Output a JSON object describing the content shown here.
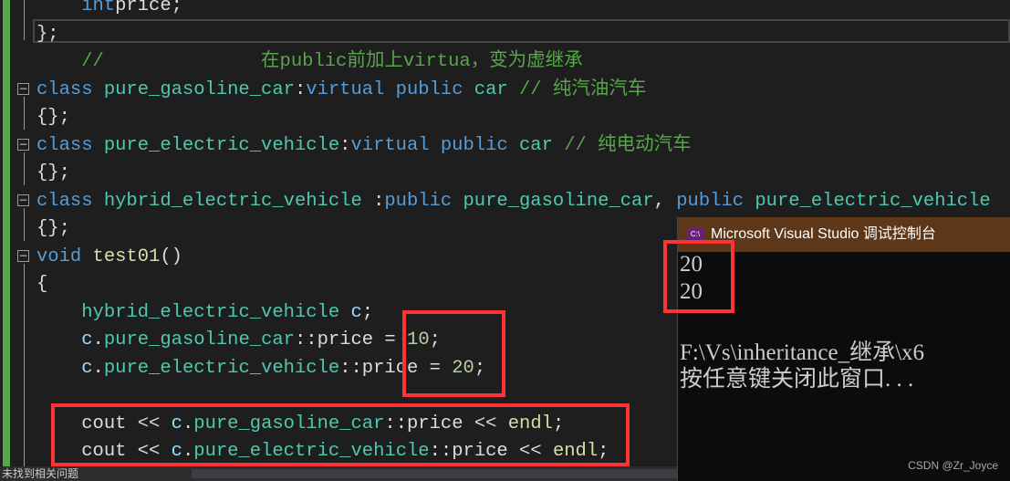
{
  "editor": {
    "lines": [
      {
        "indent": "    ",
        "parts": [
          [
            "kw",
            "int"
          ],
          [
            "",
            "price;"
          ]
        ]
      },
      {
        "indent": "",
        "parts": [
          [
            "",
            "};"
          ]
        ]
      },
      {
        "indent": "    ",
        "parts": [
          [
            "cm",
            "//              在public前加上virtua，变为虚继承"
          ]
        ]
      },
      {
        "indent": "",
        "parts": [
          [
            "kw",
            "class "
          ],
          [
            "ty",
            "pure_gasoline_car"
          ],
          [
            "",
            ":"
          ],
          [
            "kw",
            "virtual public "
          ],
          [
            "ty",
            "car"
          ],
          [
            "cm",
            " // 纯汽油汽车"
          ]
        ]
      },
      {
        "indent": "",
        "parts": [
          [
            "",
            "{};"
          ]
        ]
      },
      {
        "indent": "",
        "parts": [
          [
            "kw",
            "class "
          ],
          [
            "ty",
            "pure_electric_vehicle"
          ],
          [
            "",
            ":"
          ],
          [
            "kw",
            "virtual public "
          ],
          [
            "ty",
            "car"
          ],
          [
            "cm",
            " // 纯电动汽车"
          ]
        ]
      },
      {
        "indent": "",
        "parts": [
          [
            "",
            "{};"
          ]
        ]
      },
      {
        "indent": "",
        "parts": [
          [
            "kw",
            "class "
          ],
          [
            "ty",
            "hybrid_electric_vehicle"
          ],
          [
            "",
            " :"
          ],
          [
            "kw",
            "public "
          ],
          [
            "ty",
            "pure_gasoline_car"
          ],
          [
            "",
            ", "
          ],
          [
            "kw",
            "public "
          ],
          [
            "ty",
            "pure_electric_vehicle"
          ]
        ]
      },
      {
        "indent": "",
        "parts": [
          [
            "",
            "{};"
          ]
        ]
      },
      {
        "indent": "",
        "parts": [
          [
            "kw",
            "void "
          ],
          [
            "fn",
            "test01"
          ],
          [
            "",
            "()"
          ]
        ]
      },
      {
        "indent": "",
        "parts": [
          [
            "",
            "{"
          ]
        ]
      },
      {
        "indent": "    ",
        "parts": [
          [
            "ty",
            "hybrid_electric_vehicle "
          ],
          [
            "var",
            "c"
          ],
          [
            "",
            ";"
          ]
        ]
      },
      {
        "indent": "    ",
        "parts": [
          [
            "var",
            "c"
          ],
          [
            "",
            "."
          ],
          [
            "ty",
            "pure_gasoline_car"
          ],
          [
            "",
            "::price = "
          ],
          [
            "num",
            "10"
          ],
          [
            "",
            ";"
          ]
        ]
      },
      {
        "indent": "    ",
        "parts": [
          [
            "var",
            "c"
          ],
          [
            "",
            "."
          ],
          [
            "ty",
            "pure_electric_vehicle"
          ],
          [
            "",
            "::price = "
          ],
          [
            "num",
            "20"
          ],
          [
            "",
            ";"
          ]
        ]
      },
      {
        "indent": "",
        "parts": []
      },
      {
        "indent": "    ",
        "parts": [
          [
            "",
            "cout << "
          ],
          [
            "var",
            "c"
          ],
          [
            "",
            "."
          ],
          [
            "ty",
            "pure_gasoline_car"
          ],
          [
            "",
            "::price << "
          ],
          [
            "fn",
            "endl"
          ],
          [
            "",
            ";"
          ]
        ]
      },
      {
        "indent": "    ",
        "parts": [
          [
            "",
            "cout << "
          ],
          [
            "var",
            "c"
          ],
          [
            "",
            "."
          ],
          [
            "ty",
            "pure_electric_vehicle"
          ],
          [
            "",
            "::price << "
          ],
          [
            "fn",
            "endl"
          ],
          [
            "",
            ";"
          ]
        ]
      }
    ]
  },
  "console": {
    "title": "Microsoft Visual Studio 调试控制台",
    "icon": "console-icon",
    "icon_text": "C:\\",
    "output": [
      "20",
      "20",
      "",
      "F:\\Vs\\inheritance_继承\\x6",
      "按任意键关闭此窗口. . ."
    ]
  },
  "watermark": "CSDN @Zr_Joyce",
  "status": {
    "text": "未找到相关问题"
  },
  "colors": {
    "highlight": "#ff3333",
    "console_title": "#5e3718",
    "change_bar": "#57a64a"
  }
}
